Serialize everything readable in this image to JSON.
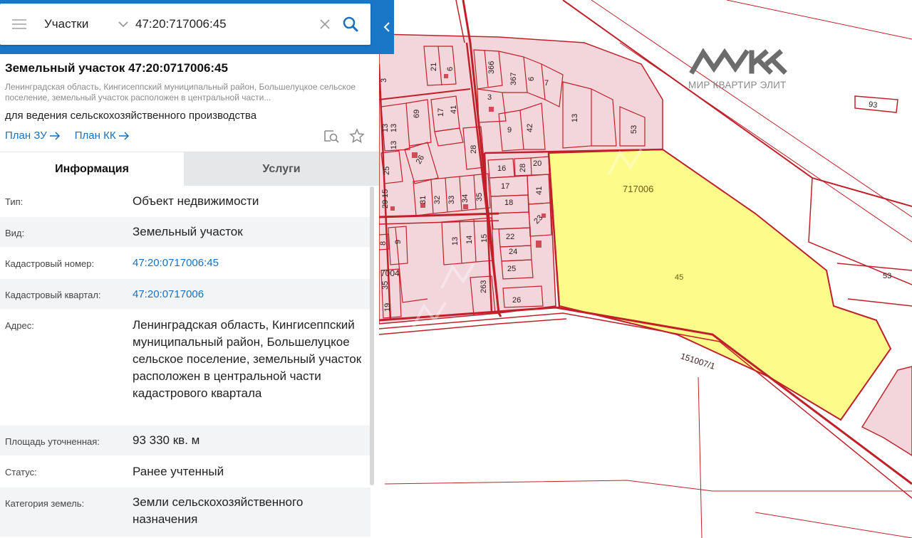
{
  "search": {
    "layer": "Участки",
    "query": "47:20:717006:45"
  },
  "object": {
    "title": "Земельный участок 47:20:0717006:45",
    "address_short": "Ленинградская область, Кингисеппский муниципальный район, Большелуцкое сельское поселение, земельный участок расположен в центральной части...",
    "purpose": "для ведения сельскохозяйственного производства",
    "plan_zu": "План ЗУ",
    "plan_kk": "План КК"
  },
  "tabs": {
    "info": "Информация",
    "services": "Услуги"
  },
  "info": {
    "type_label": "Тип:",
    "type_value": "Объект недвижимости",
    "kind_label": "Вид:",
    "kind_value": "Земельный участок",
    "cad_number_label": "Кадастровый номер:",
    "cad_number_value": "47:20:0717006:45",
    "cad_quarter_label": "Кадастровый квартал:",
    "cad_quarter_value": "47:20:0717006",
    "address_label": "Адрес:",
    "address_value": "Ленинградская область, Кингисеппский муниципальный район, Большелуцкое сельское поселение, земельный участок расположен в центральной части кадастрового квартала",
    "area_label": "Площадь уточненная:",
    "area_value": "93 330 кв. м",
    "status_label": "Статус:",
    "status_value": "Ранее учтенный",
    "category_label": "Категория земель:",
    "category_value": "Земли сельскохозяйственного назначения"
  },
  "map": {
    "quarter_label": "717006",
    "parcel_label": "45",
    "other_quarter_label": "7004",
    "road_label": "151007/1",
    "lot_93": "93",
    "lot_53_right": "53",
    "lots": [
      "21",
      "6",
      "366",
      "367",
      "6",
      "7",
      "3",
      "13",
      "69",
      "17",
      "41",
      "13",
      "9",
      "42",
      "53",
      "25",
      "26",
      "28",
      "16",
      "28",
      "20",
      "17",
      "41",
      "18",
      "23",
      "31",
      "32",
      "33",
      "34",
      "35",
      "22",
      "24",
      "25",
      "13",
      "14",
      "15",
      "9",
      "263",
      "26",
      "35",
      "19",
      "29",
      "8",
      "3",
      "13",
      "13",
      "15"
    ],
    "colors": {
      "selected_fill": "#fdfb8a",
      "parcel_fill": "#f3d6dc",
      "boundary": "#c0202a",
      "panel_accent": "#1a77c8",
      "link": "#1c6fb8"
    }
  },
  "watermark": {
    "text": "МИР КВАРТИР ЭЛИТ"
  },
  "icons": {
    "menu": "hamburger-icon",
    "dropdown": "chevron-down-icon",
    "clear": "close-icon",
    "search": "search-icon",
    "map_locate": "map-search-icon",
    "favorite": "star-icon",
    "collapse": "chevron-left-icon",
    "plan_arrow": "arrow-right-icon"
  }
}
